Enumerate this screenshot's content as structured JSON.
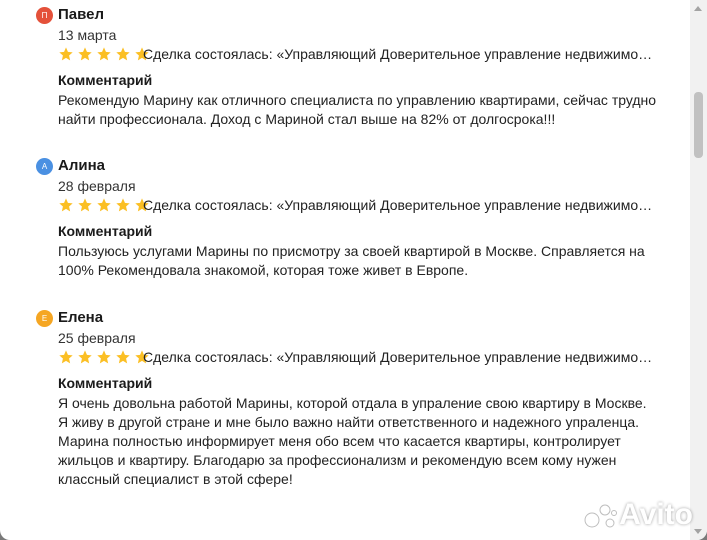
{
  "colors": {
    "star": "#fbbf24",
    "avatar_pavel": "#e4513a",
    "avatar_alina": "#4a90e2",
    "avatar_elena": "#f5a623"
  },
  "reviews": [
    {
      "avatar_letter": "П",
      "name": "Павел",
      "date": "13 марта",
      "rating": 5,
      "deal": "Сделка состоялась: «Управляющий Доверительное управление недвижимо…",
      "comment_label": "Комментарий",
      "comment": "Рекомендую Марину как отличного специалиста по управлению квартирами, сейчас трудно\nнайти профессионала. Доход  с Мариной стал выше на  82% от долгосрока!!!"
    },
    {
      "avatar_letter": "А",
      "name": "Алина",
      "date": "28 февраля",
      "rating": 5,
      "deal": "Сделка состоялась: «Управляющий Доверительное управление недвижимо…",
      "comment_label": "Комментарий",
      "comment": "Пользуюсь услугами Марины по присмотру за своей квартирой в Москве. Справляется на\n100% Рекомендовала знакомой, которая тоже живет в Европе."
    },
    {
      "avatar_letter": "Е",
      "name": "Елена",
      "date": "25 февраля",
      "rating": 5,
      "deal": "Сделка состоялась: «Управляющий Доверительное управление недвижимо…",
      "comment_label": "Комментарий",
      "comment": "Я очень довольна работой Марины,  которой  отдала в упраление свою квартиру в Москве.\nЯ живу в другой стране и мне было важно найти ответственного и надежного упраленца.\n Марина полностью информирует меня обо всем что касается квартиры, контролирует\nжильцов и квартиру. Благодарю за профессионализм и рекомендую всем кому нужен\nклассный специалист в этой сфере!"
    }
  ],
  "watermark": "Avito"
}
